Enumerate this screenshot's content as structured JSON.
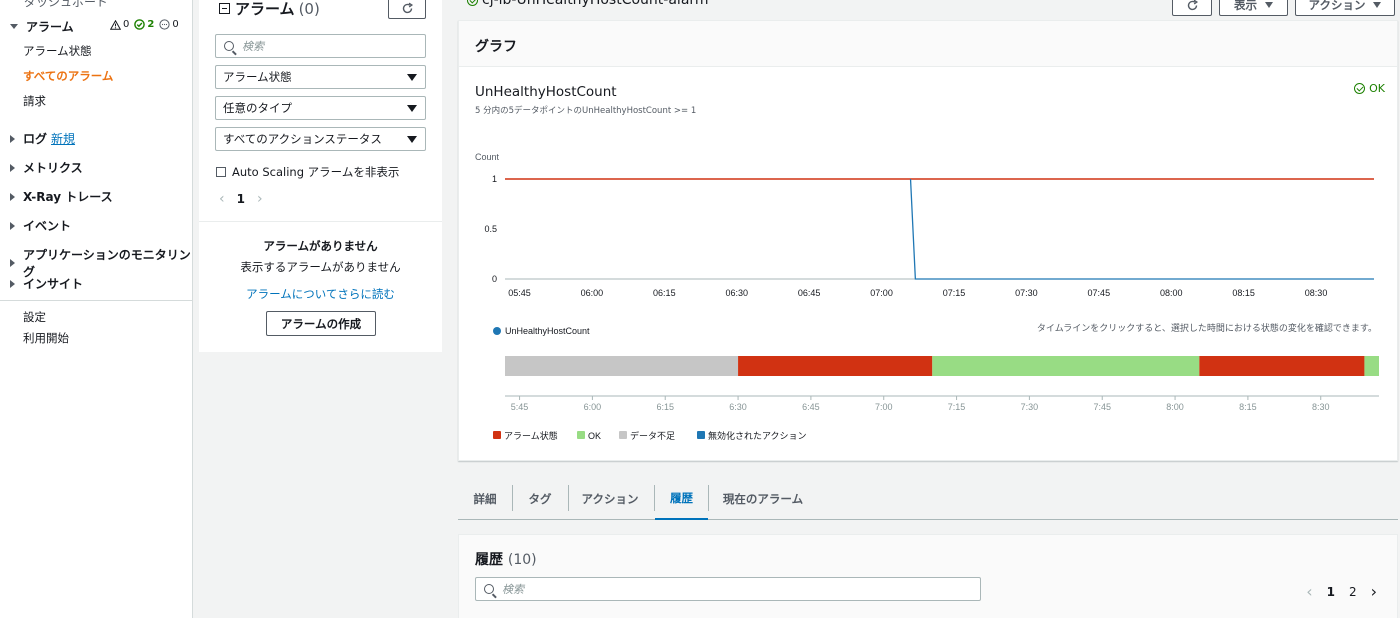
{
  "sidebar": {
    "top_cut_label": "ダッシュボード",
    "alarms_label": "アラーム",
    "badges": {
      "alarm_count": "0",
      "ok_count": "2",
      "insufficient_count": "0"
    },
    "alarm_items": [
      "アラーム状態",
      "すべてのアラーム",
      "請求"
    ],
    "sections": [
      {
        "label": "ログ",
        "extra": "新規"
      },
      {
        "label": "メトリクス"
      },
      {
        "label": "X-Ray トレース"
      },
      {
        "label": "イベント"
      },
      {
        "label": "アプリケーションのモニタリング"
      },
      {
        "label": "インサイト"
      }
    ],
    "bottom_items": [
      "設定",
      "利用開始"
    ]
  },
  "alarm_panel": {
    "title": "アラーム",
    "count": "(0)",
    "search_placeholder": "検索",
    "filters": [
      "アラーム状態",
      "任意のタイプ",
      "すべてのアクションステータス"
    ],
    "hide_autoscaling_label": "Auto Scaling アラームを非表示",
    "page": "1",
    "empty_title": "アラームがありません",
    "empty_subtitle": "表示するアラームがありません",
    "learn_more_link": "アラームについてさらに読む",
    "create_button": "アラームの作成"
  },
  "header": {
    "alarm_name": "cj-lb-UnHealthyHostCount-alarm",
    "view_button": "表示",
    "actions_button": "アクション"
  },
  "graph": {
    "section_title": "グラフ",
    "status": "OK",
    "timeline_hint": "タイムラインをクリックすると、選択した時間における状態の変化を確認できます。",
    "timeline_legend": [
      {
        "label": "アラーム状態",
        "color": "#d13212"
      },
      {
        "label": "OK",
        "color": "#98dc84"
      },
      {
        "label": "データ不足",
        "color": "#c6c6c6"
      },
      {
        "label": "無効化されたアクション",
        "color": "#1f77b4"
      }
    ],
    "timeline_segments": [
      {
        "state": "insufficient",
        "from": "05:42",
        "to": "06:30"
      },
      {
        "state": "alarm",
        "from": "06:30",
        "to": "07:10"
      },
      {
        "state": "ok",
        "from": "07:10",
        "to": "08:05"
      },
      {
        "state": "alarm",
        "from": "08:05",
        "to": "08:39"
      },
      {
        "state": "ok",
        "from": "08:39",
        "to": "08:42"
      }
    ],
    "timeline_ticks": [
      "5:45",
      "6:00",
      "6:15",
      "6:30",
      "6:45",
      "7:00",
      "7:15",
      "7:30",
      "7:45",
      "8:00",
      "8:15",
      "8:30"
    ]
  },
  "chart_data": {
    "type": "line",
    "title": "UnHealthyHostCount",
    "subtitle": "5 分内の5データポイントのUnHealthyHostCount >= 1",
    "ylabel": "Count",
    "ylim": [
      0,
      1
    ],
    "yticks": [
      "0",
      "0.5",
      "1"
    ],
    "xticks": [
      "05:45",
      "06:00",
      "06:15",
      "06:30",
      "06:45",
      "07:00",
      "07:15",
      "07:30",
      "07:45",
      "08:00",
      "08:15",
      "08:30"
    ],
    "series": [
      {
        "name": "UnHealthyHostCount",
        "color": "#1f77b4",
        "x": [
          "07:06",
          "07:07",
          "08:42"
        ],
        "values": [
          1,
          0,
          0
        ]
      }
    ],
    "threshold": {
      "value": 1,
      "color": "#d13212"
    },
    "legend_position": "bottom-left"
  },
  "tabs": [
    {
      "label": "詳細",
      "active": false
    },
    {
      "label": "タグ",
      "active": false
    },
    {
      "label": "アクション",
      "active": false
    },
    {
      "label": "履歴",
      "active": true
    },
    {
      "label": "現在のアラーム",
      "active": false
    }
  ],
  "history": {
    "title": "履歴",
    "count": "(10)",
    "search_placeholder": "検索",
    "pages": [
      "1",
      "2"
    ]
  }
}
